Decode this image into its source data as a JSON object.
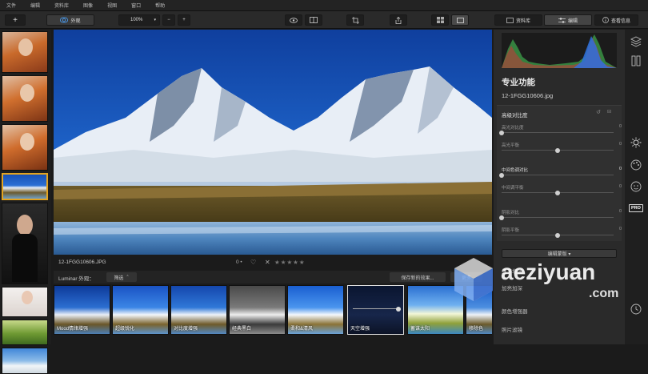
{
  "menu": [
    "文件",
    "编辑",
    "资料库",
    "图像",
    "视图",
    "窗口",
    "帮助"
  ],
  "toolbar": {
    "add_label": "+",
    "looks_label": "外观",
    "zoom_value": "100%",
    "zoom_minus": "−",
    "zoom_plus": "+",
    "library_label": "资料库",
    "edit_label": "编辑",
    "info_label": "查看信息"
  },
  "image": {
    "filename": "12-1FGG10606.JPG",
    "rating_prefix": "0 •"
  },
  "presets_bar": {
    "source_label": "Luminar 外观：",
    "filter_label": "筛选",
    "save_label": "保存新的效果...",
    "more_label": "更多"
  },
  "presets": [
    {
      "label": "Mood情绪增强"
    },
    {
      "label": "超级锐化"
    },
    {
      "label": "对比度增强"
    },
    {
      "label": "经典黑白"
    },
    {
      "label": "柔和&清风"
    },
    {
      "label": "天空增强"
    },
    {
      "label": "蓄谋太阳"
    },
    {
      "label": "移除色"
    }
  ],
  "panel": {
    "title": "专业功能",
    "filename": "12-1FGG10606.jpg",
    "section_title": "高级对比度",
    "sliders": [
      {
        "name": "高光对比度",
        "value": "0",
        "level": 0.0
      },
      {
        "name": "高光平衡",
        "value": "0",
        "level": 0.5
      },
      {
        "name": "中间色调对比",
        "value": "0",
        "level": 0.0
      },
      {
        "name": "中间调平衡",
        "value": "0",
        "level": 0.5
      },
      {
        "name": "阴影对比",
        "value": "0",
        "level": 0.0
      },
      {
        "name": "阴影平衡",
        "value": "0",
        "level": 0.5
      }
    ],
    "edit_mask_label": "编辑蒙版 ▾",
    "filters": [
      "细节增强",
      "加亮加深",
      "颜色增强器",
      "照片滤镜"
    ]
  },
  "watermark": {
    "text": "aeziyuan",
    "sub": ".com"
  },
  "colors": {
    "accent": "#e2a320",
    "sky": "#1f5fbf",
    "panel": "#2a2a2a"
  }
}
